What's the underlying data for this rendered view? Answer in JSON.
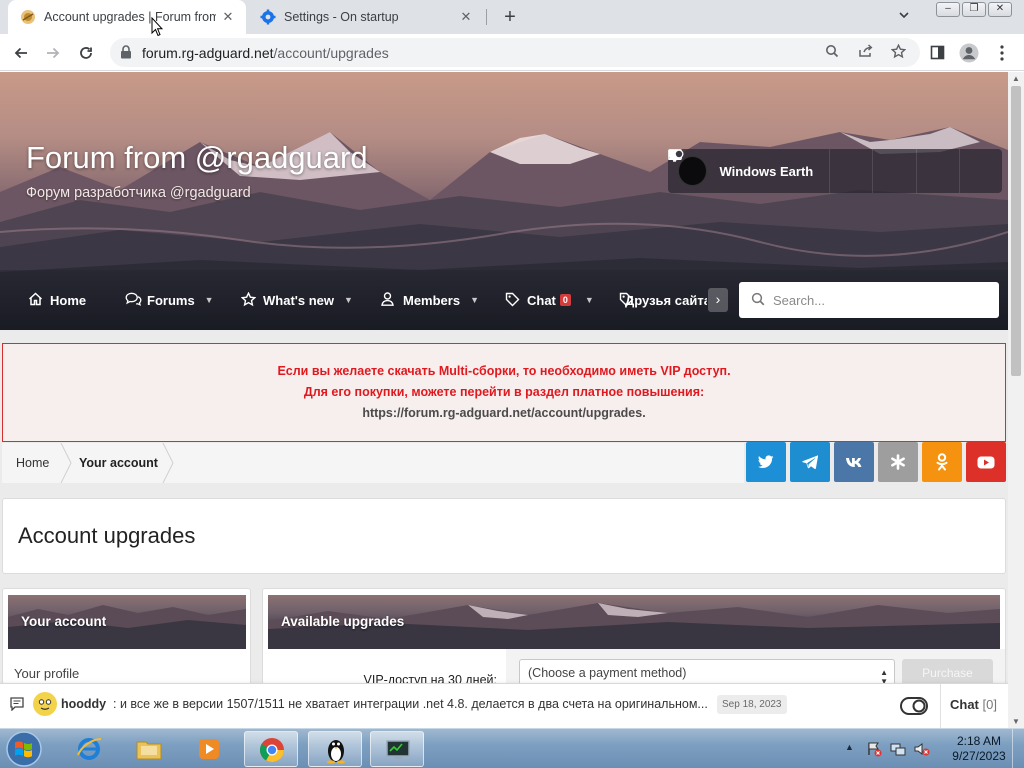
{
  "browser": {
    "tabs": [
      {
        "title": "Account upgrades | Forum from @rgadguard",
        "active": true
      },
      {
        "title": "Settings - On startup",
        "active": false
      }
    ],
    "url_host": "forum.rg-adguard.net",
    "url_path": "/account/upgrades",
    "new_tab_glyph": "+",
    "close_glyph": "✕"
  },
  "site": {
    "title": "Forum from @rgadguard",
    "subtitle": "Форум разработчика @rgadguard"
  },
  "user": {
    "name": "Windows Earth"
  },
  "nav": {
    "items": [
      {
        "label": "Home",
        "icon": "home-icon"
      },
      {
        "label": "Forums",
        "icon": "comments-icon"
      },
      {
        "label": "What's new",
        "icon": "star-icon"
      },
      {
        "label": "Members",
        "icon": "user-icon"
      },
      {
        "label": "Chat",
        "icon": "tag-icon",
        "badge": "0"
      },
      {
        "label": "Друзья сайта",
        "icon": "tag-icon"
      }
    ],
    "search_placeholder": "Search..."
  },
  "notice": {
    "line1": "Если вы желаете скачать Multi-сборки, то необходимо иметь VIP доступ.",
    "line2": "Для его покупки, можете перейти в раздел платное повышения:",
    "line3": "https://forum.rg-adguard.net/account/upgrades."
  },
  "breadcrumb": {
    "home": "Home",
    "current": "Your account"
  },
  "socials": [
    {
      "name": "twitter",
      "color": "#1d8fd6"
    },
    {
      "name": "telegram",
      "color": "#1f8ed0"
    },
    {
      "name": "vk",
      "color": "#4a76a8"
    },
    {
      "name": "livejournal",
      "color": "#9e9e9e"
    },
    {
      "name": "odnoklassniki",
      "color": "#f59310"
    },
    {
      "name": "youtube",
      "color": "#dc3029"
    }
  ],
  "page": {
    "title": "Account upgrades"
  },
  "sidebar": {
    "heading": "Your account",
    "link": "Your profile"
  },
  "upgrades": {
    "heading": "Available upgrades",
    "row_label": "VIP-доступ на 30 дней:",
    "payment_placeholder": "(Choose a payment method)",
    "purchase_label": "Purchase"
  },
  "shoutbox": {
    "user": "hooddy",
    "message": ": и все же в версии 1507/1511 не хватает интеграции .net 4.8. делается в два счета на оригинальном...",
    "date": "Sep 18, 2023",
    "chat_label": "Chat",
    "chat_count": "[0]"
  },
  "taskbar": {
    "time": "2:18 AM",
    "date": "9/27/2023"
  },
  "colors": {
    "notice_red": "#e0191f",
    "nav_bg": "#1c1f28",
    "taskbar": "#7d9fc1"
  }
}
